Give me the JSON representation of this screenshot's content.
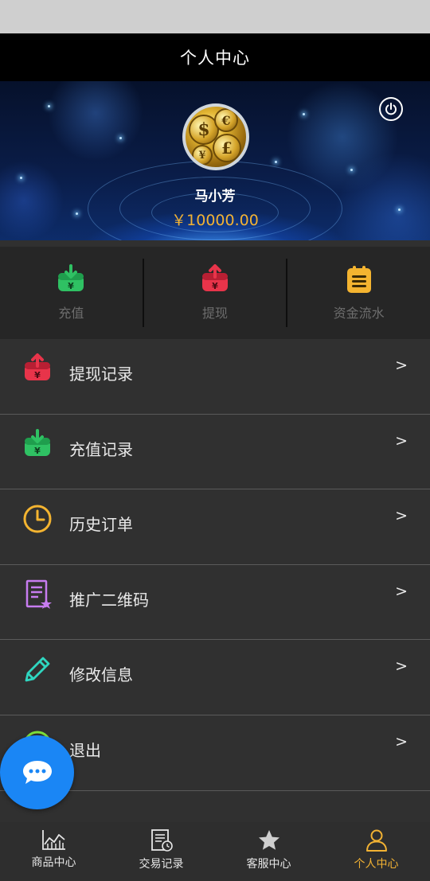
{
  "header": {
    "title": "个人中心"
  },
  "profile": {
    "username": "马小芳",
    "balance": "￥10000.00",
    "power_icon": "power-icon",
    "avatar_icon": "gold-coins-avatar"
  },
  "quick_actions": [
    {
      "label": "充值",
      "icon": "deposit-icon",
      "color": "#2fc163"
    },
    {
      "label": "提现",
      "icon": "withdraw-icon",
      "color": "#e8344a"
    },
    {
      "label": "资金流水",
      "icon": "statement-icon",
      "color": "#f4b430"
    }
  ],
  "menu": [
    {
      "label": "提现记录",
      "icon": "withdraw-icon",
      "color": "#e8344a",
      "chevron": ">"
    },
    {
      "label": "充值记录",
      "icon": "deposit-icon",
      "color": "#2fc163",
      "chevron": ">"
    },
    {
      "label": "历史订单",
      "icon": "clock-icon",
      "color": "#f4b430",
      "chevron": ">"
    },
    {
      "label": "推广二维码",
      "icon": "document-star-icon",
      "color": "#c77cf0",
      "chevron": ">"
    },
    {
      "label": "修改信息",
      "icon": "pencil-icon",
      "color": "#2fd6c0",
      "chevron": ">"
    },
    {
      "label": "退出",
      "icon": "logout-icon",
      "color": "#7ee03a",
      "chevron": ">"
    }
  ],
  "chat": {
    "icon": "chat-bubble-icon"
  },
  "tabbar": [
    {
      "label": "商品中心",
      "icon": "chart-icon",
      "active": false
    },
    {
      "label": "交易记录",
      "icon": "receipt-clock-icon",
      "active": false
    },
    {
      "label": "客服中心",
      "icon": "star-icon",
      "active": false
    },
    {
      "label": "个人中心",
      "icon": "person-icon",
      "active": true
    }
  ],
  "colors": {
    "accent": "#f2b233",
    "background": "#303030",
    "chat_button": "#1a86f5"
  }
}
